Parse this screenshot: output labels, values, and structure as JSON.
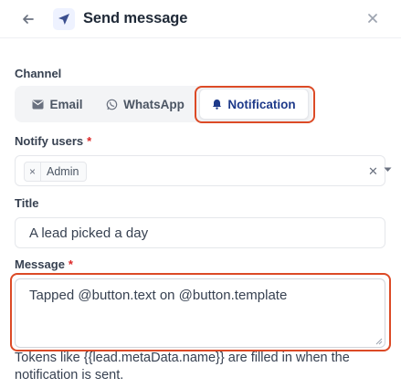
{
  "header": {
    "title": "Send message"
  },
  "channel": {
    "label": "Channel",
    "options": [
      {
        "label": "Email",
        "icon": "mail-icon"
      },
      {
        "label": "WhatsApp",
        "icon": "whatsapp-icon"
      },
      {
        "label": "Notification",
        "icon": "bell-icon",
        "selected": true
      }
    ]
  },
  "notify_users": {
    "label": "Notify users",
    "required_mark": "*",
    "selected": [
      "Admin"
    ]
  },
  "title_field": {
    "label": "Title",
    "value": "A lead picked a day"
  },
  "message_field": {
    "label": "Message",
    "required_mark": "*",
    "value": "Tapped @button.text on @button.template"
  },
  "hint": "Tokens like {{lead.metaData.name}} are filled in when the notification is sent.",
  "colors": {
    "accent": "#1e3a8a",
    "highlight": "#dc4a26",
    "required": "#dc2626"
  }
}
